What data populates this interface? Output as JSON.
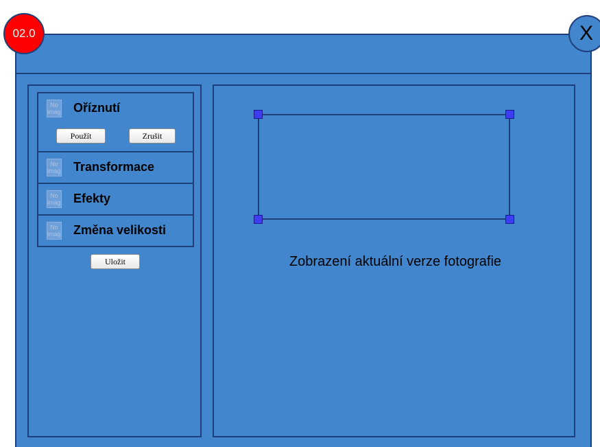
{
  "window": {
    "version_badge": "02.0",
    "close_label": "X"
  },
  "tools": [
    {
      "label": "Oříznutí",
      "icon_text": "No image"
    },
    {
      "label": "Transformace",
      "icon_text": "No image"
    },
    {
      "label": "Efekty",
      "icon_text": "No image"
    },
    {
      "label": "Změna velikosti",
      "icon_text": "No image"
    }
  ],
  "crop_buttons": {
    "apply_label": "Použít",
    "cancel_label": "Zrušit"
  },
  "save_label": "Uložit",
  "preview": {
    "caption": "Zobrazení aktuální verze fotografie"
  },
  "colors": {
    "window_bg": "#4287cd",
    "border": "#1f3f7a",
    "badge": "#ff0000",
    "handle": "#3d3df2"
  }
}
